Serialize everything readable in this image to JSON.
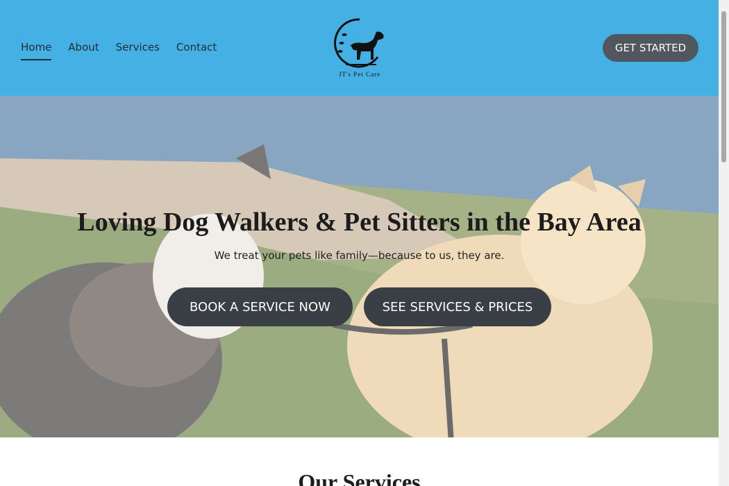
{
  "nav": {
    "items": [
      {
        "label": "Home",
        "active": true
      },
      {
        "label": "About",
        "active": false
      },
      {
        "label": "Services",
        "active": false
      },
      {
        "label": "Contact",
        "active": false
      }
    ]
  },
  "logo": {
    "text": "JT's Pet Care"
  },
  "header": {
    "cta_label": "GET STARTED"
  },
  "hero": {
    "title": "Loving Dog Walkers & Pet Sitters in the Bay Area",
    "subtitle": "We treat your pets like family—because to us, they are.",
    "book_label": "BOOK A SERVICE NOW",
    "prices_label": "SEE SERVICES & PRICES"
  },
  "services": {
    "heading": "Our Services"
  },
  "colors": {
    "header_bg": "#45b0e3",
    "button_bg": "#3a3f46",
    "cta_bg": "#50575e"
  }
}
